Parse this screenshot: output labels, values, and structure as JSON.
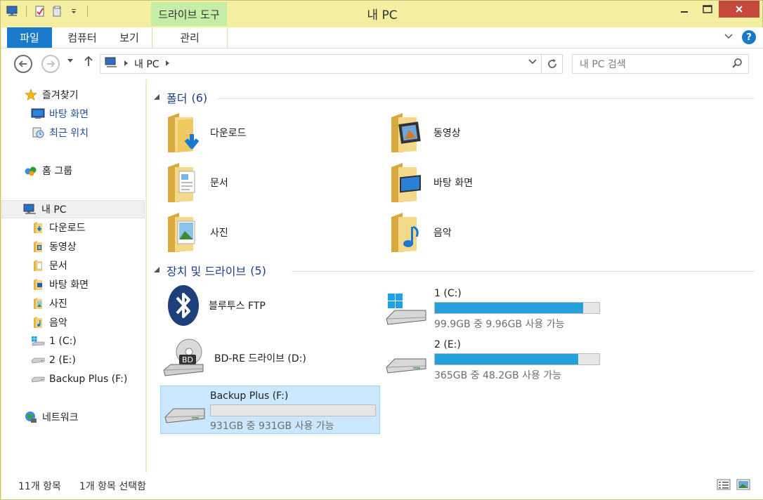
{
  "window": {
    "title": "내 PC",
    "context_tab_header": "드라이브 도구",
    "controls": {
      "minimize": "—",
      "maximize": "☐",
      "close": "✕"
    }
  },
  "ribbon": {
    "tabs": [
      {
        "label": "파일"
      },
      {
        "label": "컴퓨터"
      },
      {
        "label": "보기"
      },
      {
        "label": "관리"
      }
    ],
    "help": "?"
  },
  "address": {
    "crumb": "내 PC",
    "search_placeholder": "내 PC 검색"
  },
  "nav": {
    "favorites": [
      {
        "label": "즐겨찾기",
        "icon": "star-icon"
      },
      {
        "label": "바탕 화면",
        "icon": "desktop-icon"
      },
      {
        "label": "최근 위치",
        "icon": "recent-places-icon"
      }
    ],
    "homegroup": {
      "label": "홈 그룹",
      "icon": "homegroup-icon"
    },
    "this_pc": {
      "label": "내 PC",
      "icon": "computer-icon"
    },
    "pc_children": [
      {
        "label": "다운로드",
        "icon": "downloads-folder-icon"
      },
      {
        "label": "동영상",
        "icon": "videos-folder-icon"
      },
      {
        "label": "문서",
        "icon": "documents-folder-icon"
      },
      {
        "label": "바탕 화면",
        "icon": "desktop-folder-icon"
      },
      {
        "label": "사진",
        "icon": "pictures-folder-icon"
      },
      {
        "label": "음악",
        "icon": "music-folder-icon"
      },
      {
        "label": "1 (C:)",
        "icon": "windows-drive-icon"
      },
      {
        "label": "2 (E:)",
        "icon": "drive-icon"
      },
      {
        "label": "Backup Plus (F:)",
        "icon": "drive-icon"
      }
    ],
    "network": {
      "label": "네트워크",
      "icon": "network-icon"
    }
  },
  "groups": {
    "folders": {
      "title": "폴더",
      "count": "(6)"
    },
    "devices": {
      "title": "장치 및 드라이브",
      "count": "(5)"
    }
  },
  "folders": [
    {
      "label": "다운로드",
      "icon": "downloads-folder-icon"
    },
    {
      "label": "동영상",
      "icon": "videos-folder-icon"
    },
    {
      "label": "문서",
      "icon": "documents-folder-icon"
    },
    {
      "label": "바탕 화면",
      "icon": "desktop-folder-icon"
    },
    {
      "label": "사진",
      "icon": "pictures-folder-icon"
    },
    {
      "label": "음악",
      "icon": "music-folder-icon"
    }
  ],
  "devices": {
    "bluetooth": {
      "label": "블루투스 FTP",
      "icon": "bluetooth-icon"
    },
    "bd": {
      "label": "BD-RE 드라이브 (D:)",
      "icon": "bd-drive-icon",
      "disc_text": "BD"
    },
    "c": {
      "label": "1 (C:)",
      "free": "99.9GB 중 9.96GB 사용 가능",
      "used_fraction": 0.9,
      "icon": "windows-drive-icon"
    },
    "e": {
      "label": "2 (E:)",
      "free": "365GB 중 48.2GB 사용 가능",
      "used_fraction": 0.87,
      "icon": "drive-icon"
    },
    "f": {
      "label": "Backup Plus (F:)",
      "free": "931GB 중 931GB 사용 가능",
      "used_fraction": 0.0,
      "icon": "drive-icon",
      "selected": true
    }
  },
  "status": {
    "item_count": "11개 항목",
    "selected_count": "1개 항목 선택함"
  },
  "colors": {
    "accent": "#1979ca",
    "drive_bar": "#26a0da",
    "context_tab": "#c5eda6",
    "selection": "#cce8ff",
    "title_bg": "#f3eea0"
  }
}
